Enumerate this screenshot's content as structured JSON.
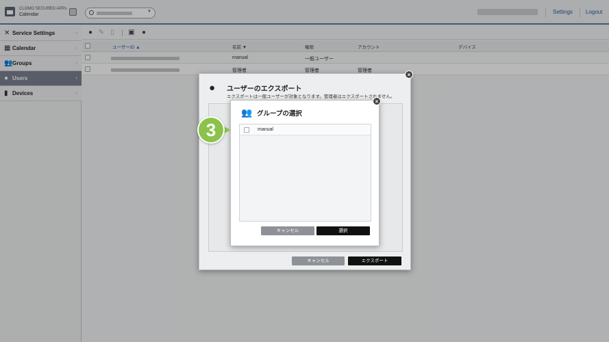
{
  "header": {
    "brand_name": "CLOMO SECURED APPs",
    "app_name": "Calendar",
    "settings_label": "Settings",
    "logout_label": "Logout"
  },
  "sidebar": {
    "items": [
      {
        "label": "Service Settings",
        "icon": "tools-icon"
      },
      {
        "label": "Calendar",
        "icon": "calendar-icon"
      },
      {
        "label": "Groups",
        "icon": "groups-icon"
      },
      {
        "label": "Users",
        "icon": "user-icon",
        "active": true
      },
      {
        "label": "Devices",
        "icon": "devices-icon"
      }
    ]
  },
  "table": {
    "columns": [
      "ユーザーID ▲",
      "名前 ▼",
      "権限",
      "アカウント",
      "デバイス"
    ],
    "rows": [
      {
        "name": "manual",
        "role": "一般ユーザー",
        "account": ""
      },
      {
        "name": "管理者",
        "role": "管理者",
        "account": "管理者"
      }
    ]
  },
  "export_dialog": {
    "title": "ユーザーのエクスポート",
    "description": "エクスポートは一般ユーザーが対象となります。管理者はエクスポートされません。",
    "cancel_label": "キャンセル",
    "export_label": "エクスポート"
  },
  "group_dialog": {
    "title": "グループの選択",
    "groups": [
      "manual"
    ],
    "cancel_label": "キャンセル",
    "select_label": "選択"
  },
  "step_marker": "3",
  "colors": {
    "accent": "#2d5b9e",
    "step": "#8bc34a",
    "active_nav": "#7a8290"
  }
}
